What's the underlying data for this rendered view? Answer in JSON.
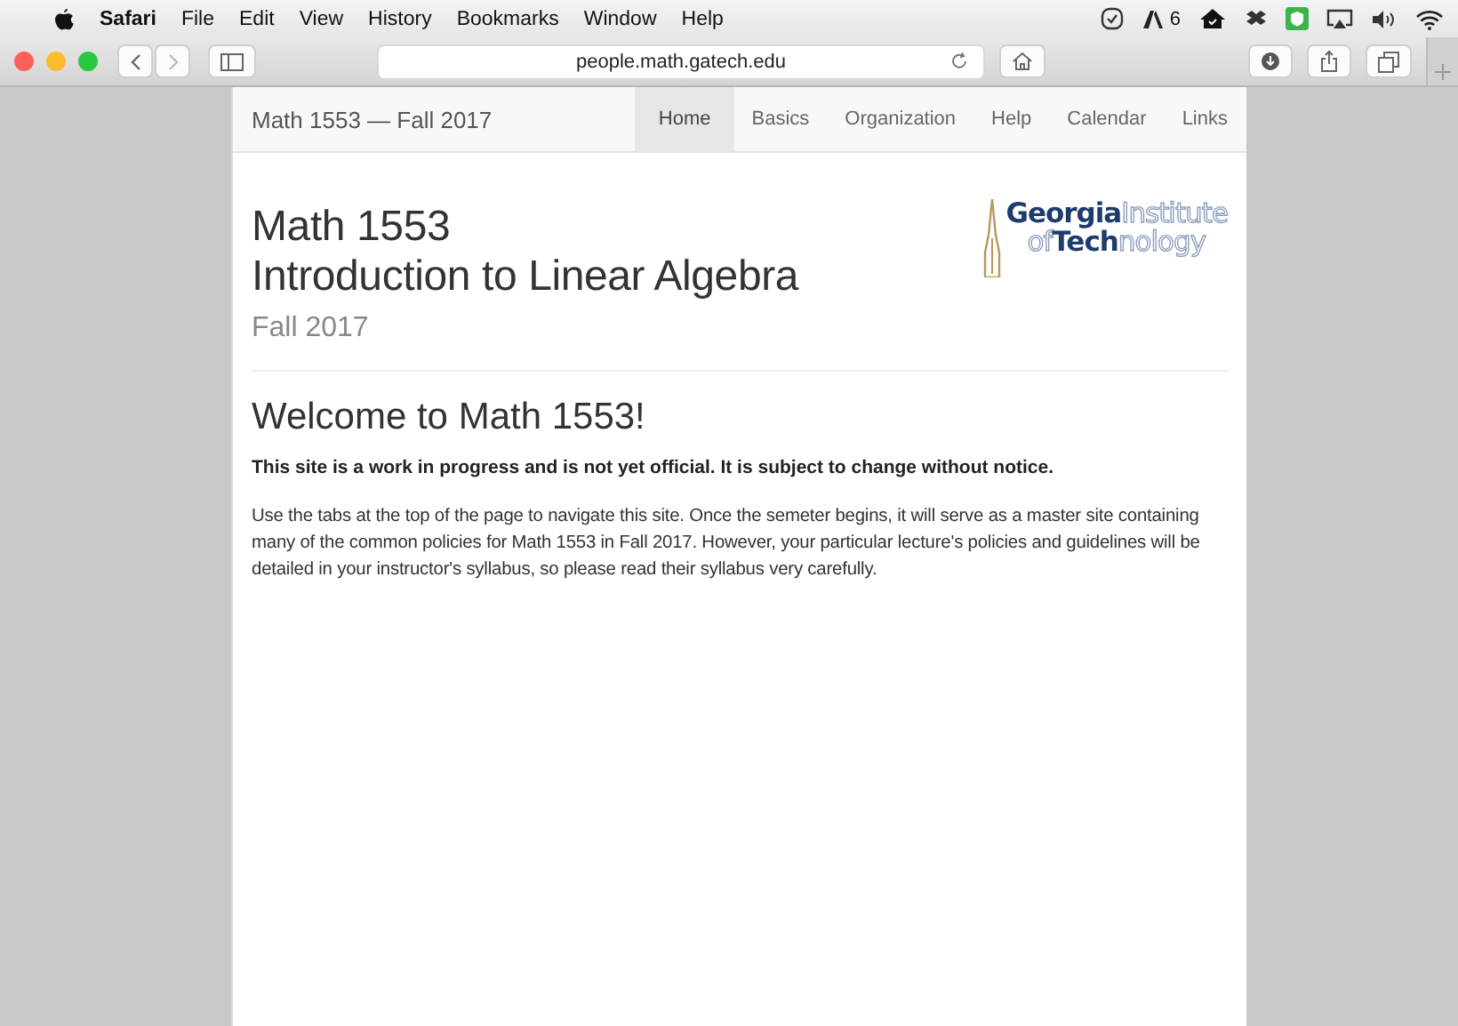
{
  "menu_bar": {
    "app": "Safari",
    "items": [
      "File",
      "Edit",
      "View",
      "History",
      "Bookmarks",
      "Window",
      "Help"
    ],
    "badge_count": "6"
  },
  "toolbar": {
    "address": "people.math.gatech.edu"
  },
  "navbar": {
    "brand": "Math 1553 — Fall 2017",
    "tabs": [
      {
        "label": "Home",
        "selected": true
      },
      {
        "label": "Basics",
        "selected": false
      },
      {
        "label": "Organization",
        "selected": false
      },
      {
        "label": "Help",
        "selected": false
      },
      {
        "label": "Calendar",
        "selected": false
      },
      {
        "label": "Links",
        "selected": false
      }
    ]
  },
  "header": {
    "title_lines": [
      "Math 1553",
      "Introduction to Linear Algebra"
    ],
    "subtitle": "Fall 2017",
    "logo": {
      "lines": [
        [
          {
            "text": "Georgia",
            "emphasis": true
          },
          {
            "text": "Institute",
            "emphasis": false
          }
        ],
        [
          {
            "text": "of",
            "emphasis": false
          },
          {
            "text": "Tech",
            "emphasis": true
          },
          {
            "text": "nology",
            "emphasis": false
          }
        ]
      ]
    }
  },
  "content": {
    "heading": "Welcome to Math 1553!",
    "notice": "This site is a work in progress and is not yet official. It is subject to change without notice.",
    "paragraph": "Use the tabs at the top of the page to navigate this site. Once the semeter begins, it will serve as a master site containing many of the common policies for Math 1553 in Fall 2017. However, your particular lecture's policies and guidelines will be detailed in your instructor's syllabus, so please read their syllabus very carefully."
  }
}
